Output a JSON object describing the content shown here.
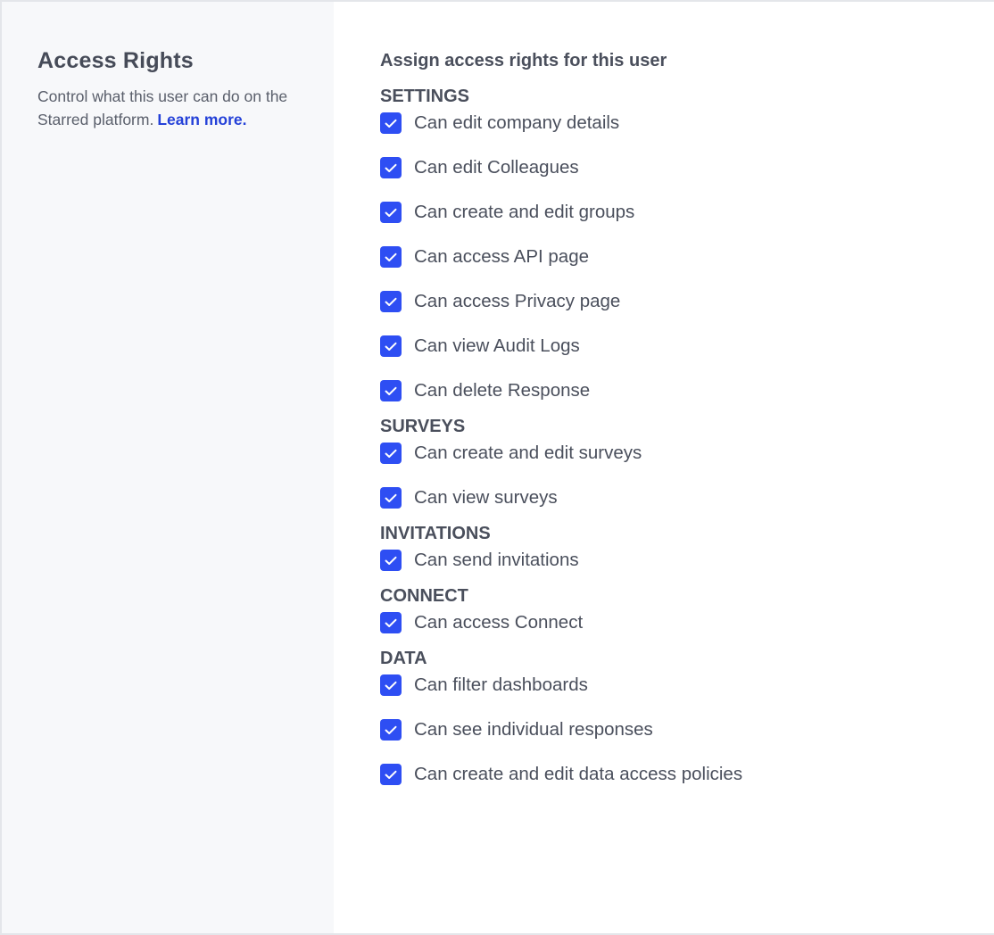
{
  "left": {
    "title": "Access Rights",
    "description": "Control what this user can do on the Starred platform.",
    "learn_more": "Learn more."
  },
  "main": {
    "heading": "Assign access rights for this user",
    "sections": [
      {
        "title": "SETTINGS",
        "options": [
          {
            "label": "Can edit company details",
            "checked": true
          },
          {
            "label": "Can edit Colleagues",
            "checked": true
          },
          {
            "label": "Can create and edit groups",
            "checked": true
          },
          {
            "label": "Can access API page",
            "checked": true
          },
          {
            "label": "Can access Privacy page",
            "checked": true
          },
          {
            "label": "Can view Audit Logs",
            "checked": true
          },
          {
            "label": "Can delete Response",
            "checked": true
          }
        ]
      },
      {
        "title": "SURVEYS",
        "options": [
          {
            "label": "Can create and edit surveys",
            "checked": true
          },
          {
            "label": "Can view surveys",
            "checked": true
          }
        ]
      },
      {
        "title": "INVITATIONS",
        "options": [
          {
            "label": "Can send invitations",
            "checked": true
          }
        ]
      },
      {
        "title": "CONNECT",
        "options": [
          {
            "label": "Can access Connect",
            "checked": true
          }
        ]
      },
      {
        "title": "DATA",
        "options": [
          {
            "label": "Can filter dashboards",
            "checked": true
          },
          {
            "label": "Can see individual responses",
            "checked": true
          },
          {
            "label": "Can create and edit data access policies",
            "checked": true
          }
        ]
      }
    ]
  },
  "colors": {
    "checkbox": "#2e4ef3",
    "link": "#2441d8",
    "panel_bg": "#f7f8fa"
  },
  "icons": {
    "checkbox": "checkmark-icon"
  }
}
